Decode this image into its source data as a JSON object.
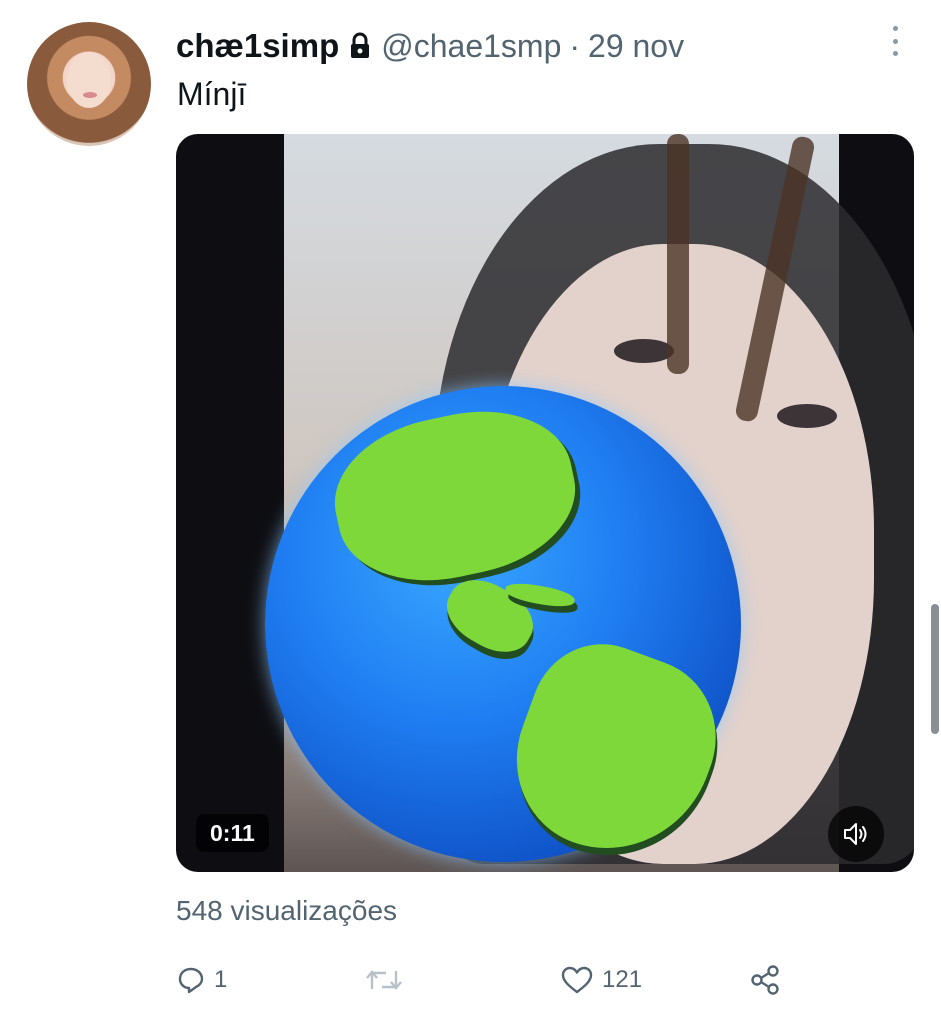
{
  "tweet": {
    "author_name": "chæ1simp",
    "handle": "@chae1smp",
    "separator": "·",
    "date": "29 nov",
    "text": "Mínjī",
    "locked_icon": "lock-icon",
    "more_icon": "more-vertical-icon"
  },
  "media": {
    "duration": "0:11",
    "mute_icon": "speaker-icon",
    "overlay_emoji": "globe-americas"
  },
  "stats": {
    "views": "548 visualizações"
  },
  "actions": {
    "reply_count": "1",
    "retweet_count": "",
    "like_count": "121",
    "reply_icon": "reply-icon",
    "retweet_icon": "retweet-icon",
    "like_icon": "heart-icon",
    "share_icon": "share-icon"
  },
  "colors": {
    "text_primary": "#0f1419",
    "text_secondary": "#536471"
  }
}
